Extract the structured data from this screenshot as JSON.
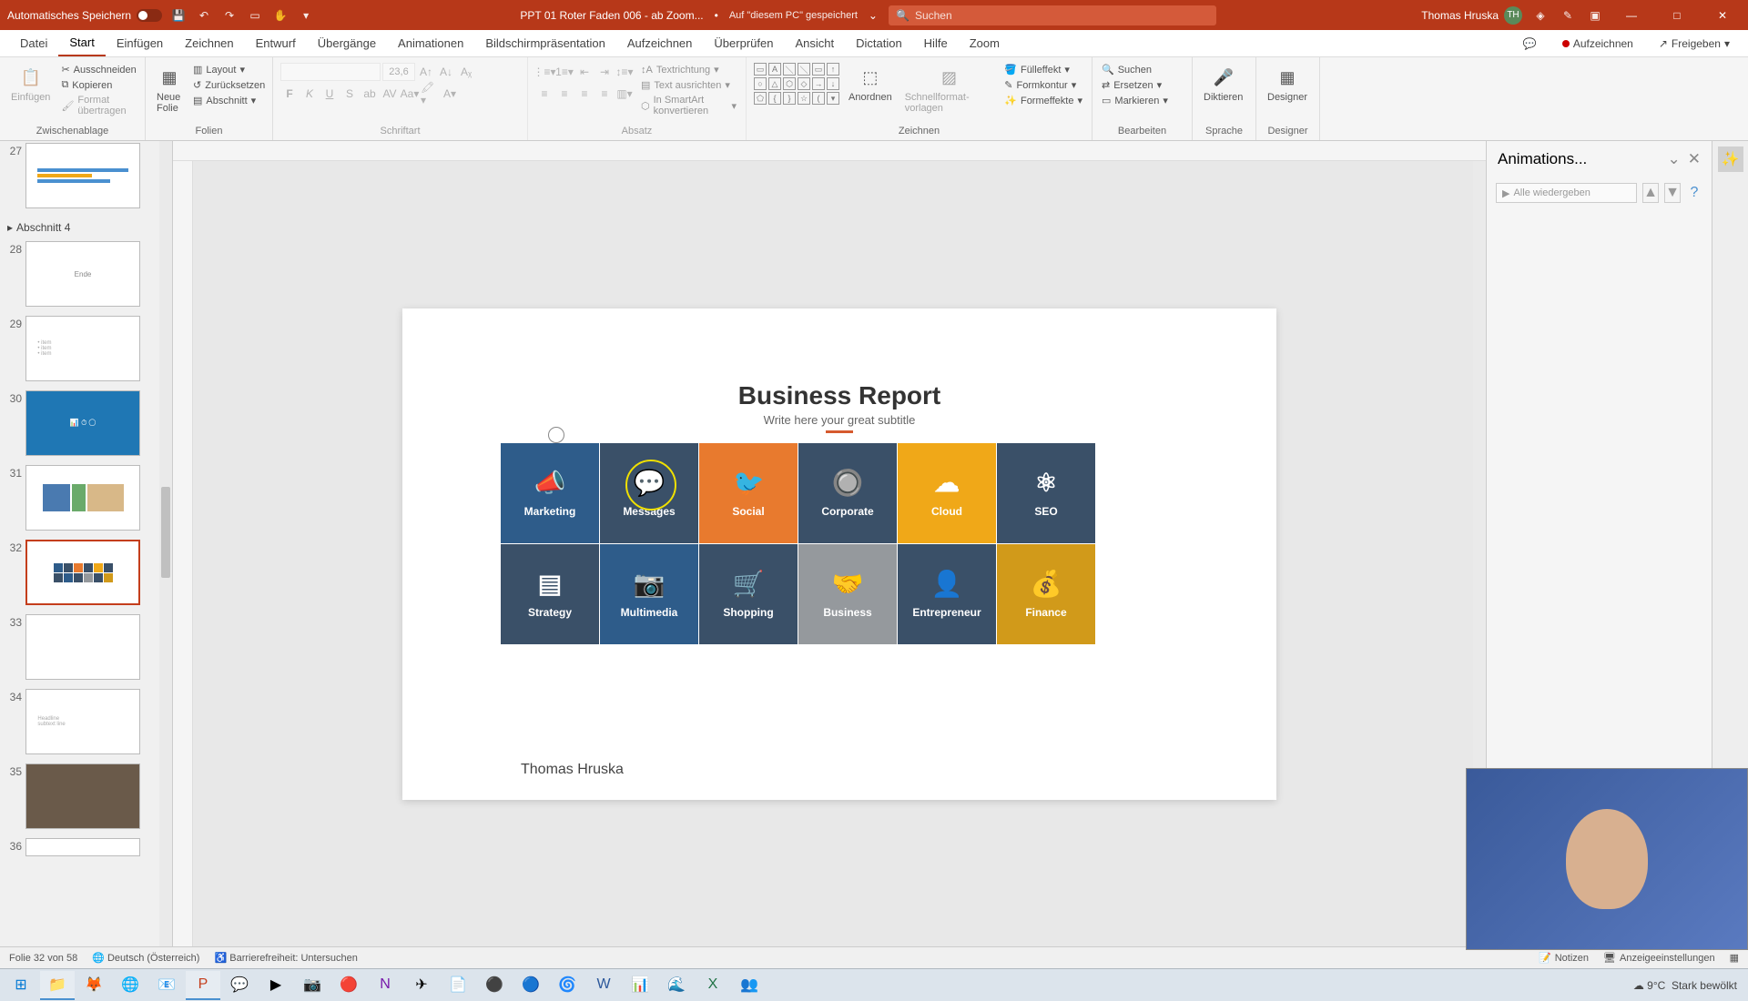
{
  "titlebar": {
    "autosave_label": "Automatisches Speichern",
    "doc_name": "PPT 01 Roter Faden 006 - ab Zoom...",
    "save_location": "Auf \"diesem PC\" gespeichert",
    "search_placeholder": "Suchen",
    "user_name": "Thomas Hruska",
    "user_initials": "TH"
  },
  "ribbon_tabs": {
    "file": "Datei",
    "home": "Start",
    "insert": "Einfügen",
    "draw": "Zeichnen",
    "design": "Entwurf",
    "transitions": "Übergänge",
    "animations": "Animationen",
    "slideshow": "Bildschirmpräsentation",
    "record": "Aufzeichnen",
    "review": "Überprüfen",
    "view": "Ansicht",
    "dictation": "Dictation",
    "help": "Hilfe",
    "zoom": "Zoom",
    "record_btn": "Aufzeichnen",
    "share_btn": "Freigeben"
  },
  "ribbon": {
    "clipboard": {
      "label": "Zwischenablage",
      "paste": "Einfügen",
      "cut": "Ausschneiden",
      "copy": "Kopieren",
      "format_painter": "Format übertragen"
    },
    "slides": {
      "label": "Folien",
      "new_slide": "Neue Folie",
      "layout": "Layout",
      "reset": "Zurücksetzen",
      "section": "Abschnitt"
    },
    "font": {
      "label": "Schriftart",
      "size": "23,6"
    },
    "paragraph": {
      "label": "Absatz",
      "text_direction": "Textrichtung",
      "align_text": "Text ausrichten",
      "convert_smartart": "In SmartArt konvertieren"
    },
    "drawing": {
      "label": "Zeichnen",
      "arrange": "Anordnen",
      "quick_styles": "Schnellformat-vorlagen",
      "shape_fill": "Fülleffekt",
      "shape_outline": "Formkontur",
      "shape_effects": "Formeffekte"
    },
    "editing": {
      "label": "Bearbeiten",
      "find": "Suchen",
      "replace": "Ersetzen",
      "select": "Markieren"
    },
    "voice": {
      "label": "Sprache",
      "dictate": "Diktieren"
    },
    "designer": {
      "label": "Designer",
      "btn": "Designer"
    }
  },
  "slide_panel": {
    "section": "Abschnitt 4",
    "thumbs": [
      {
        "num": "27",
        "content": "gantt"
      },
      {
        "num": "28",
        "content": "Ende"
      },
      {
        "num": "29",
        "content": "list"
      },
      {
        "num": "30",
        "content": "dashboard-blue"
      },
      {
        "num": "31",
        "content": "blocks"
      },
      {
        "num": "32",
        "content": "tiles"
      },
      {
        "num": "33",
        "content": ""
      },
      {
        "num": "34",
        "content": "text"
      },
      {
        "num": "35",
        "content": "photo"
      },
      {
        "num": "36",
        "content": ""
      }
    ]
  },
  "slide": {
    "title": "Business Report",
    "subtitle": "Write here your great subtitle",
    "author": "Thomas Hruska",
    "tiles": [
      {
        "label": "Marketing",
        "color": "c-blue",
        "icon": "📣"
      },
      {
        "label": "Messages",
        "color": "c-navy",
        "icon": "💬"
      },
      {
        "label": "Social",
        "color": "c-orange",
        "icon": "🐦"
      },
      {
        "label": "Corporate",
        "color": "c-navy",
        "icon": "🔘"
      },
      {
        "label": "Cloud",
        "color": "c-amber",
        "icon": "☁"
      },
      {
        "label": "SEO",
        "color": "c-navy",
        "icon": "⚛"
      },
      {
        "label": "Strategy",
        "color": "c-navy",
        "icon": "▤"
      },
      {
        "label": "Multimedia",
        "color": "c-blue",
        "icon": "📷"
      },
      {
        "label": "Shopping",
        "color": "c-navy",
        "icon": "🛒"
      },
      {
        "label": "Business",
        "color": "c-grey",
        "icon": "🤝"
      },
      {
        "label": "Entrepreneur",
        "color": "c-navy",
        "icon": "👤"
      },
      {
        "label": "Finance",
        "color": "c-darkamber",
        "icon": "💰"
      }
    ]
  },
  "anim_pane": {
    "title": "Animations...",
    "play_all": "Alle wiedergeben"
  },
  "statusbar": {
    "slide_info": "Folie 32 von 58",
    "language": "Deutsch (Österreich)",
    "accessibility": "Barrierefreiheit: Untersuchen",
    "notes": "Notizen",
    "display_settings": "Anzeigeeinstellungen"
  },
  "taskbar": {
    "temp": "9°C",
    "weather": "Stark bewölkt"
  }
}
